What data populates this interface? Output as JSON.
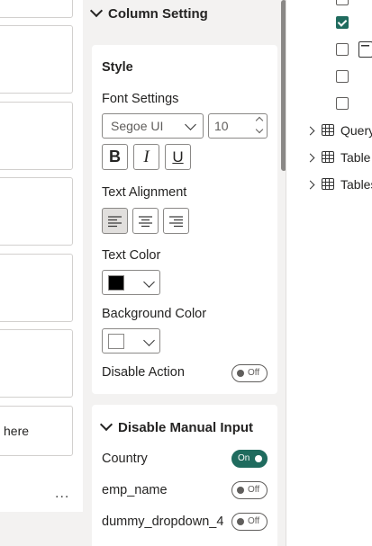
{
  "left_canvas": {
    "card_label": "here",
    "more_label": "..."
  },
  "column_setting": {
    "title": "Column Setting",
    "style": {
      "title": "Style",
      "font_settings_label": "Font Settings",
      "font_family": "Segoe UI",
      "font_size": "10",
      "bold_glyph": "B",
      "italic_glyph": "I",
      "underline_glyph": "U",
      "text_alignment_label": "Text Alignment",
      "alignment_selected": "left",
      "text_color_label": "Text Color",
      "text_color": "#000000",
      "background_color_label": "Background Color",
      "background_color": "#ffffff",
      "disable_action_label": "Disable Action",
      "disable_action_state": "Off"
    }
  },
  "disable_manual_input": {
    "title": "Disable Manual Input",
    "items": [
      {
        "label": "Country",
        "state": "On"
      },
      {
        "label": "emp_name",
        "state": "Off"
      },
      {
        "label": "dummy_dropdown_4",
        "state": "Off"
      }
    ]
  },
  "fields": {
    "tables": [
      {
        "label": "Query",
        "icon": "table-icon"
      },
      {
        "label": "Table",
        "icon": "table-icon"
      },
      {
        "label": "Tables",
        "icon": "table-icon"
      }
    ]
  },
  "colors": {
    "accent": "#1f6b5e",
    "pane_background": "#f3f2f1"
  }
}
